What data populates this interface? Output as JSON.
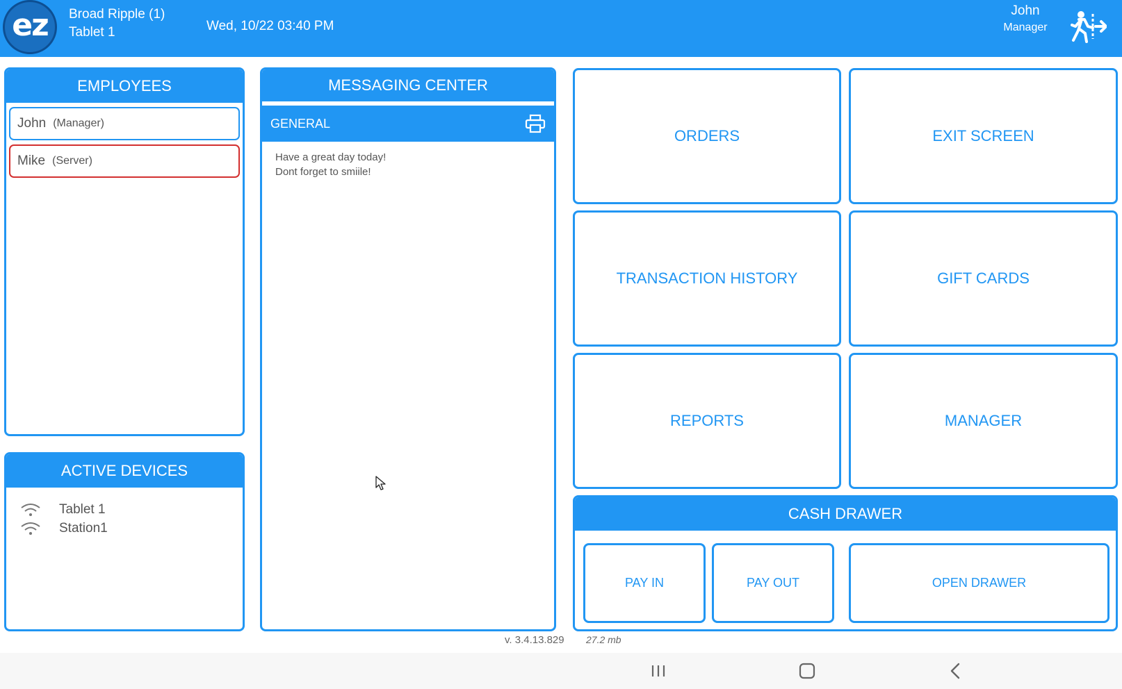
{
  "header": {
    "logo_text": "ez",
    "location": "Broad Ripple (1)",
    "device": "Tablet 1",
    "datetime": "Wed, 10/22 03:40 PM",
    "user_name": "John",
    "user_role": "Manager",
    "logout_icon": "logout-walk-icon"
  },
  "employees": {
    "title": "EMPLOYEES",
    "items": [
      {
        "name": "John",
        "role": "(Manager)"
      },
      {
        "name": "Mike",
        "role": "(Server)"
      }
    ]
  },
  "active_devices": {
    "title": "ACTIVE DEVICES",
    "items": [
      {
        "name": "Tablet 1",
        "icon": "wifi-icon"
      },
      {
        "name": "Station1",
        "icon": "wifi-icon"
      }
    ]
  },
  "messaging": {
    "title": "MESSAGING CENTER",
    "section": "GENERAL",
    "lines": [
      "Have a great day today!",
      "Dont forget to smiile!"
    ]
  },
  "actions": {
    "orders": "ORDERS",
    "exit_screen": "EXIT SCREEN",
    "transaction_history": "TRANSACTION HISTORY",
    "gift_cards": "GIFT CARDS",
    "reports": "REPORTS",
    "manager": "MANAGER"
  },
  "cash_drawer": {
    "title": "CASH DRAWER",
    "pay_in": "PAY IN",
    "pay_out": "PAY OUT",
    "open_drawer": "OPEN DRAWER"
  },
  "footer": {
    "version": "v. 3.4.13.829",
    "memory": "27.2  mb"
  },
  "colors": {
    "accent": "#2196f3",
    "alert": "#d32f2f"
  }
}
